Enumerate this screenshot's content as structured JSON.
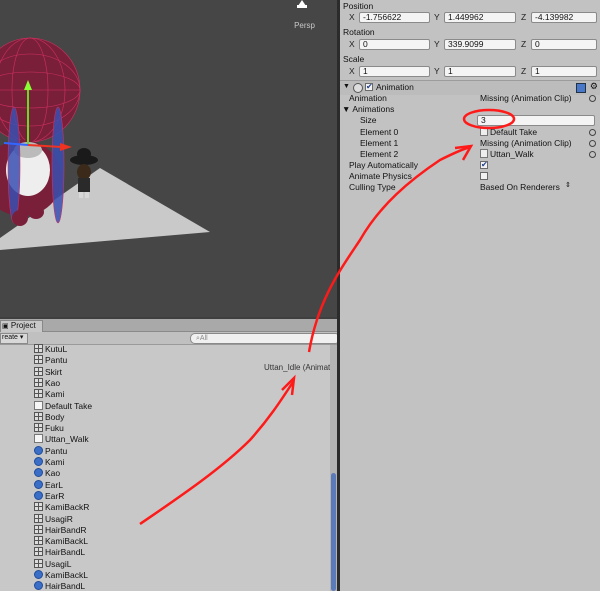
{
  "scene": {
    "persp_label": "Persp"
  },
  "inspector": {
    "position": {
      "label": "Position",
      "x_label": "X",
      "x": "-1.756622",
      "y_label": "Y",
      "y": "1.449962",
      "z_label": "Z",
      "z": "-4.139982"
    },
    "rotation": {
      "label": "Rotation",
      "x_label": "X",
      "x": "0",
      "y_label": "Y",
      "y": "339.9099",
      "z_label": "Z",
      "z": "0"
    },
    "scale": {
      "label": "Scale",
      "x_label": "X",
      "x": "1",
      "y_label": "Y",
      "y": "1",
      "z_label": "Z",
      "z": "1"
    },
    "component": {
      "title": "Animation",
      "enabled": true,
      "rows": {
        "animation_label": "Animation",
        "animation_value": "Missing (Animation Clip)",
        "animations_label": "Animations",
        "size_label": "Size",
        "size_value": "3",
        "element0_label": "Element 0",
        "element0_value": "Default Take",
        "element1_label": "Element 1",
        "element1_value": "Missing (Animation Clip)",
        "element2_label": "Element 2",
        "element2_value": "Uttan_Walk",
        "play_auto_label": "Play Automatically",
        "animate_physics_label": "Animate Physics",
        "culling_label": "Culling Type",
        "culling_value": "Based On Renderers"
      }
    }
  },
  "project": {
    "tab_label": "Project",
    "create_label": "reate",
    "search_placeholder": "All",
    "preview_label": "Uttan_Idle (AnimationClip)",
    "items": [
      {
        "label": "KutuL",
        "icon": "mesh"
      },
      {
        "label": "Pantu",
        "icon": "mesh"
      },
      {
        "label": "Skirt",
        "icon": "mesh"
      },
      {
        "label": "Kao",
        "icon": "mesh"
      },
      {
        "label": "Kami",
        "icon": "mesh"
      },
      {
        "label": "Default Take",
        "icon": "anim"
      },
      {
        "label": "Body",
        "icon": "mesh"
      },
      {
        "label": "Fuku",
        "icon": "mesh"
      },
      {
        "label": "Uttan_Walk",
        "icon": "anim"
      },
      {
        "label": "Pantu",
        "icon": "gameobject"
      },
      {
        "label": "Kami",
        "icon": "gameobject"
      },
      {
        "label": "Kao",
        "icon": "gameobject"
      },
      {
        "label": "EarL",
        "icon": "gameobject"
      },
      {
        "label": "EarR",
        "icon": "gameobject"
      },
      {
        "label": "KamiBackR",
        "icon": "mesh"
      },
      {
        "label": "UsagiR",
        "icon": "mesh"
      },
      {
        "label": "HairBandR",
        "icon": "mesh"
      },
      {
        "label": "KamiBackL",
        "icon": "mesh"
      },
      {
        "label": "HairBandL",
        "icon": "mesh"
      },
      {
        "label": "UsagiL",
        "icon": "mesh"
      },
      {
        "label": "KamiBackL",
        "icon": "gameobject"
      },
      {
        "label": "HairBandL",
        "icon": "gameobject"
      }
    ]
  },
  "colors": {
    "annotation": "#ff1a1a",
    "scene_bg": "#464646",
    "inspector_bg": "#c2c2c2",
    "scroll_thumb": "#5a7ab8"
  }
}
